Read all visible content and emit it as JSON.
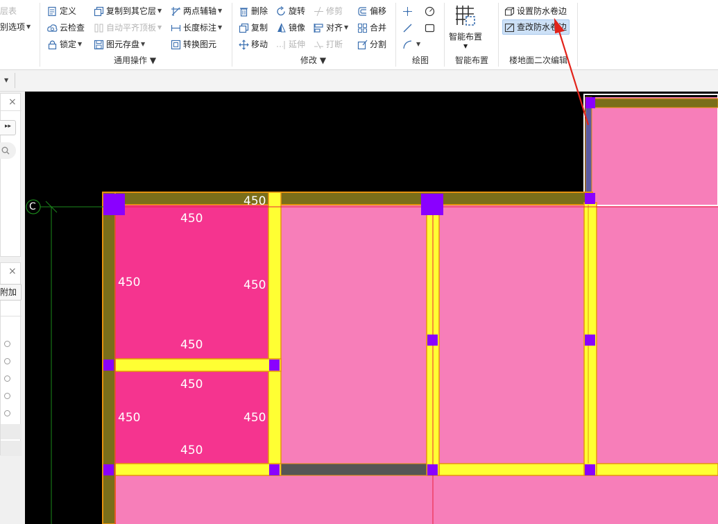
{
  "ribbon": {
    "col0": {
      "layer_table": "层表",
      "recognize_options": "别选项"
    },
    "general": {
      "define": "定义",
      "copy_to_layer": "复制到其它层",
      "two_point_axis": "两点辅轴",
      "cloud_check": "云检查",
      "auto_flush_top": "自动平齐顶板",
      "length_dim": "长度标注",
      "lock": "锁定",
      "save_element": "图元存盘",
      "convert_element": "转换图元",
      "group_label": "通用操作"
    },
    "modify": {
      "delete": "删除",
      "rotate": "旋转",
      "trim": "修剪",
      "offset": "偏移",
      "copy": "复制",
      "mirror": "镜像",
      "align": "对齐",
      "merge": "合并",
      "move": "移动",
      "extend": "延伸",
      "break": "打断",
      "split": "分割",
      "group_label": "修改"
    },
    "draw": {
      "group_label": "绘图"
    },
    "smart": {
      "button": "智能布置",
      "group_label": "智能布置"
    },
    "floor_edit": {
      "set_waterproof_edge": "设置防水卷边",
      "edit_waterproof_edge": "查改防水卷边",
      "group_label": "楼地面二次编辑"
    }
  },
  "left_panel": {
    "close_symbol": "×",
    "attach_label": "附加"
  },
  "canvas": {
    "axis_label": "C",
    "dimensions": {
      "top_beam": "450",
      "room1_top": "450",
      "room1_left": "450",
      "room1_right": "450",
      "room1_bottom": "450",
      "room2_top": "450",
      "room2_left": "450",
      "room2_right": "450",
      "room2_bottom": "450"
    }
  },
  "colors": {
    "canvas_bg": "#000000",
    "slab_pink": "#f77eb9",
    "room_magenta": "#f5348f",
    "wall_yellow": "#ffff33",
    "wall_border": "#e6920f",
    "beam_olive": "#7a6e1a",
    "column_purple": "#8a00ff",
    "axis_green": "#1c8a1c",
    "axis_red": "#e8203a",
    "arrow_red": "#e2231a",
    "selected_bg": "#cde1f7"
  }
}
